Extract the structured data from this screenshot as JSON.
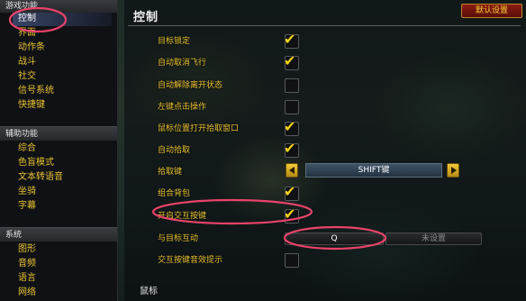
{
  "sidebar": {
    "categories": [
      {
        "title": "游戏功能",
        "items": [
          "控制",
          "界面",
          "动作条",
          "战斗",
          "社交",
          "信号系统",
          "快捷键"
        ]
      },
      {
        "title": "辅助功能",
        "items": [
          "综合",
          "色盲模式",
          "文本转语音",
          "坐骑",
          "字幕"
        ]
      },
      {
        "title": "系统",
        "items": [
          "图形",
          "音频",
          "语言",
          "网络"
        ]
      }
    ],
    "selected": "控制"
  },
  "panel": {
    "title": "控制",
    "defaults_button": "默认设置",
    "options": [
      {
        "label": "目标锁定",
        "checked": true
      },
      {
        "label": "自动取消飞行",
        "checked": true
      },
      {
        "label": "自动解除离开状态",
        "checked": false
      },
      {
        "label": "左键点击操作",
        "checked": false
      },
      {
        "label": "鼠标位置打开拾取窗口",
        "checked": true
      },
      {
        "label": "自动拾取",
        "checked": true
      },
      {
        "label": "组合背包",
        "checked": true
      },
      {
        "label": "开启交互按键",
        "checked": true
      },
      {
        "label": "交互按键音效提示",
        "checked": false
      }
    ],
    "loot_key": {
      "label": "拾取键",
      "value": "SHIFT键"
    },
    "interact_target": {
      "label": "与目标互动",
      "primary_key": "Q",
      "secondary_key": "未设置"
    },
    "mouse_section": "鼠标"
  },
  "colors": {
    "label_gold": "#e9c232",
    "check_yellow": "#f2d21a",
    "annotation_pink": "#e9436a"
  }
}
